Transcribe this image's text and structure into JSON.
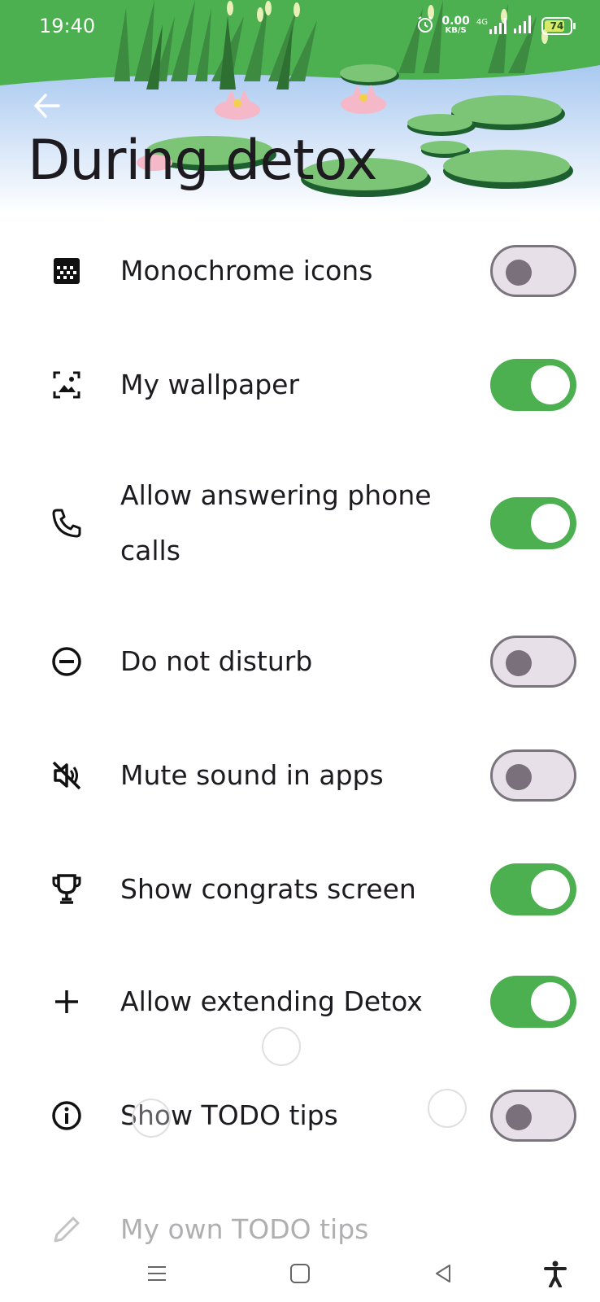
{
  "status_bar": {
    "time": "19:40",
    "net_speed_value": "0.00",
    "net_speed_unit": "KB/S",
    "network_type": "4G",
    "battery_level": "74"
  },
  "header": {
    "title": "During detox",
    "back_icon": "arrow-left-icon"
  },
  "settings": [
    {
      "label": "Monochrome icons",
      "icon": "monochrome-grid-icon",
      "enabled": false
    },
    {
      "label": "My wallpaper",
      "icon": "wallpaper-image-icon",
      "enabled": true
    },
    {
      "label": "Allow answering phone calls",
      "icon": "phone-icon",
      "enabled": true
    },
    {
      "label": "Do not disturb",
      "icon": "do-not-disturb-icon",
      "enabled": false
    },
    {
      "label": "Mute sound in apps",
      "icon": "mute-icon",
      "enabled": false
    },
    {
      "label": "Show congrats screen",
      "icon": "trophy-icon",
      "enabled": true
    },
    {
      "label": "Allow extending Detox",
      "icon": "plus-icon",
      "enabled": true
    },
    {
      "label": "Show TODO tips",
      "icon": "info-icon",
      "enabled": false
    },
    {
      "label": "My own TODO tips",
      "icon": "pencil-icon"
    }
  ],
  "colors": {
    "switch_on": "#4caf50",
    "switch_off_track": "#e8e0e8",
    "header_green": "#4caf50",
    "water_blue": "#b8d4f0"
  },
  "nav_bar": {
    "menu_icon": "menu-icon",
    "home_icon": "home-square-icon",
    "back_icon": "back-triangle-icon",
    "accessibility_icon": "accessibility-icon"
  }
}
